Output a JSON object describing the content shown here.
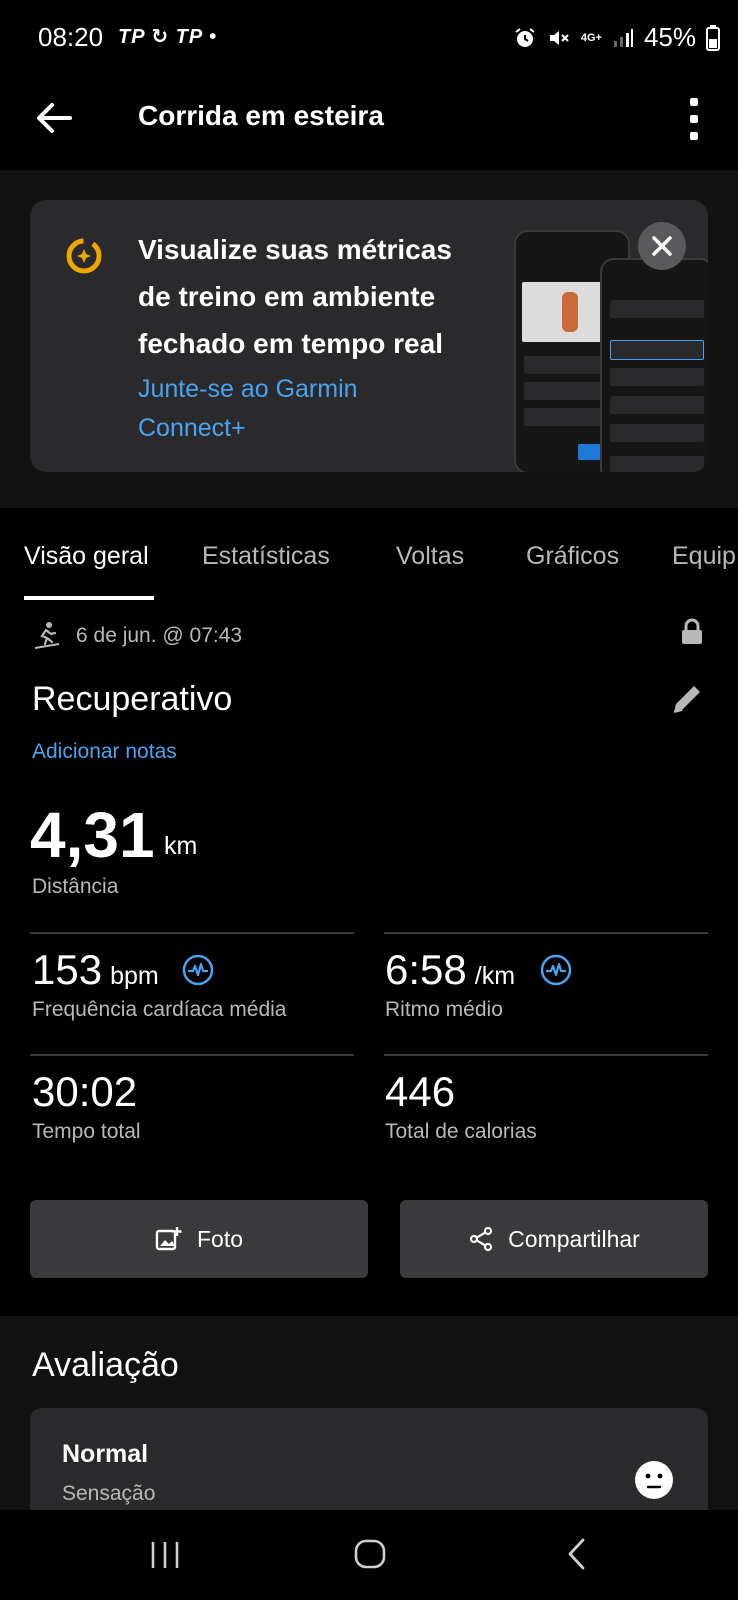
{
  "status_bar": {
    "time": "08:20",
    "left_icons": "TP ↻ TP •",
    "battery": "45%",
    "network": "4G+"
  },
  "app_bar": {
    "title": "Corrida em esteira"
  },
  "promo": {
    "title": "Visualize suas métricas de treino em ambiente fechado em tempo real",
    "link": "Junte-se ao Garmin Connect+"
  },
  "tabs": [
    {
      "label": "Visão geral",
      "active": true
    },
    {
      "label": "Estatísticas",
      "active": false
    },
    {
      "label": "Voltas",
      "active": false
    },
    {
      "label": "Gráficos",
      "active": false
    },
    {
      "label": "Equip",
      "active": false
    }
  ],
  "activity": {
    "date": "6 de jun. @ 07:43",
    "name": "Recuperativo",
    "add_notes": "Adicionar notas",
    "distance": {
      "value": "4,31",
      "unit": "km",
      "label": "Distância"
    },
    "heart_rate": {
      "value": "153",
      "unit": "bpm",
      "label": "Frequência cardíaca média"
    },
    "pace": {
      "value": "6:58",
      "unit": "/km",
      "label": "Ritmo médio"
    },
    "time": {
      "value": "30:02",
      "label": "Tempo total"
    },
    "calories": {
      "value": "446",
      "label": "Total de calorias"
    }
  },
  "buttons": {
    "photo": "Foto",
    "share": "Compartilhar"
  },
  "rating": {
    "title": "Avaliação",
    "value": "Normal",
    "label": "Sensação"
  },
  "colors": {
    "accent_link": "#4aa3f0",
    "logo_gold": "#f0a800",
    "card_bg": "#2a2a2c",
    "background": "#000000"
  },
  "icons": [
    "back-arrow-icon",
    "kebab-menu-icon",
    "connect-plus-logo-icon",
    "close-icon",
    "treadmill-runner-icon",
    "lock-icon",
    "pencil-icon",
    "heart-wave-icon",
    "add-photo-icon",
    "share-icon",
    "neutral-face-icon"
  ]
}
